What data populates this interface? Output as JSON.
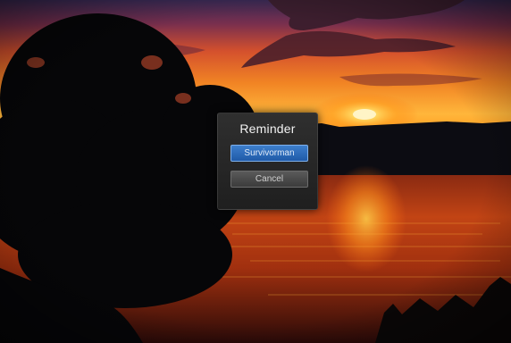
{
  "dialog": {
    "title": "Reminder",
    "buttons": [
      {
        "label": "Survivorman",
        "state": "selected"
      },
      {
        "label": "Cancel",
        "state": "normal"
      }
    ]
  },
  "colors": {
    "selected_button": "#2a67b6",
    "dialog_background": "#272727",
    "sun": "#ffb21c"
  }
}
